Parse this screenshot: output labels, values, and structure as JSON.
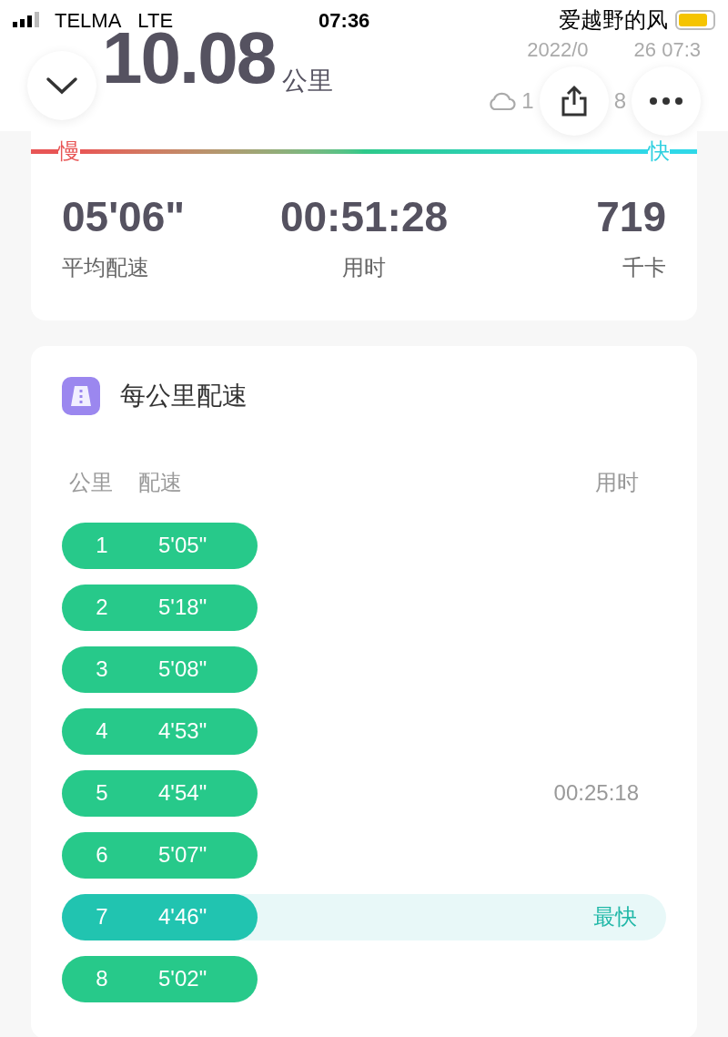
{
  "status_bar": {
    "carrier": "TELMA",
    "network": "LTE",
    "time": "07:36",
    "right_text": "爱越野的风"
  },
  "header": {
    "distance": "10.08",
    "unit": "公里",
    "date_parts": [
      "2022/0",
      "26 07:3"
    ],
    "weather_parts": [
      "1",
      "8"
    ]
  },
  "speed_scale": {
    "slow": "慢",
    "fast": "快"
  },
  "summary": [
    {
      "value": "05'06\"",
      "label": "平均配速"
    },
    {
      "value": "00:51:28",
      "label": "用时"
    },
    {
      "value": "719",
      "label": "千卡"
    }
  ],
  "splits": {
    "title": "每公里配速",
    "columns": [
      "公里",
      "配速",
      "用时"
    ],
    "rows": [
      {
        "km": "1",
        "pace": "5'05\"",
        "fastest": false
      },
      {
        "km": "2",
        "pace": "5'18\"",
        "fastest": false
      },
      {
        "km": "3",
        "pace": "5'08\"",
        "fastest": false
      },
      {
        "km": "4",
        "pace": "4'53\"",
        "fastest": false
      },
      {
        "km": "5",
        "pace": "4'54\"",
        "fastest": false,
        "time": "00:25:18"
      },
      {
        "km": "6",
        "pace": "5'07\"",
        "fastest": false
      },
      {
        "km": "7",
        "pace": "4'46\"",
        "fastest": true,
        "badge": "最快"
      },
      {
        "km": "8",
        "pace": "5'02\"",
        "fastest": false
      }
    ]
  }
}
